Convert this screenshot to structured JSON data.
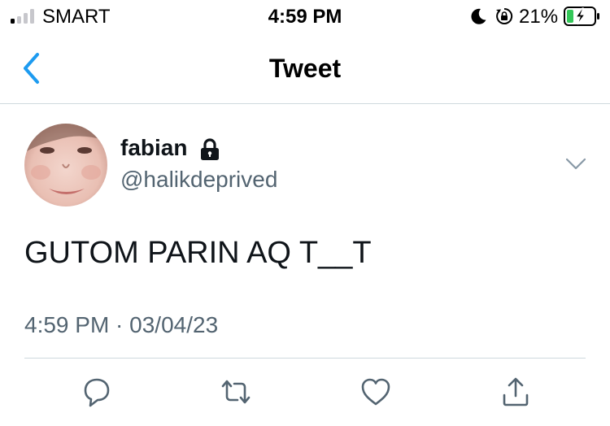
{
  "status_bar": {
    "carrier": "SMART",
    "time": "4:59 PM",
    "battery_percent": "21%",
    "signal_bars_active": 1,
    "icons": [
      "signal-icon",
      "moon-icon",
      "rotation-lock-icon",
      "battery-charging-icon"
    ]
  },
  "nav": {
    "title": "Tweet",
    "back_icon": "chevron-left-icon"
  },
  "tweet": {
    "author": {
      "display_name": "fabian",
      "handle": "@halikdeprived",
      "protected_icon": "lock-icon"
    },
    "text": "GUTOM PARIN AQ T__T",
    "timestamp": "4:59 PM · 03/04/23",
    "more_icon": "chevron-down-icon"
  },
  "actions": [
    {
      "name": "reply",
      "icon": "reply-icon"
    },
    {
      "name": "retweet",
      "icon": "retweet-icon"
    },
    {
      "name": "like",
      "icon": "heart-icon"
    },
    {
      "name": "share",
      "icon": "share-icon"
    }
  ],
  "colors": {
    "accent": "#1d9bf0",
    "secondary_text": "#536471",
    "divider": "#cfd9de",
    "battery_charging": "#34c759"
  }
}
